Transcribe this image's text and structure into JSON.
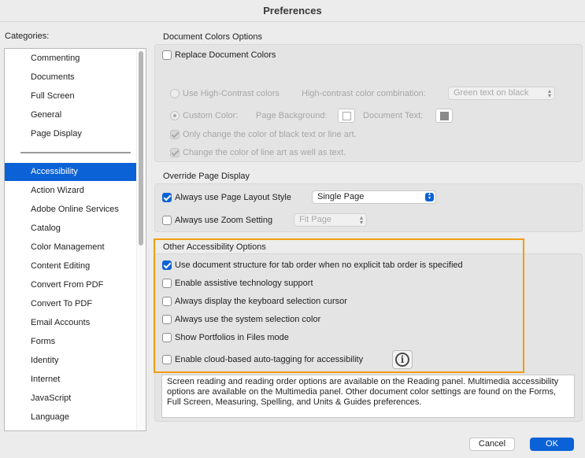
{
  "window": {
    "title": "Preferences"
  },
  "categories": {
    "label": "Categories:",
    "items_top": [
      "Commenting",
      "Documents",
      "Full Screen",
      "General",
      "Page Display"
    ],
    "items_bottom": [
      "Accessibility",
      "Action Wizard",
      "Adobe Online Services",
      "Catalog",
      "Color Management",
      "Content Editing",
      "Convert From PDF",
      "Convert To PDF",
      "Email Accounts",
      "Forms",
      "Identity",
      "Internet",
      "JavaScript",
      "Language"
    ],
    "selected": "Accessibility"
  },
  "document_colors": {
    "title": "Document Colors Options",
    "replace_label": "Replace Document Colors",
    "replace_checked": false,
    "high_contrast_label": "Use High-Contrast colors",
    "high_contrast_combo_label": "High-contrast color combination:",
    "high_contrast_combo_value": "Green text on black",
    "custom_color_label": "Custom Color:",
    "page_background_label": "Page Background:",
    "document_text_label": "Document Text:",
    "only_black_label": "Only change the color of black text or line art.",
    "line_art_label": "Change the color of line art as well as text."
  },
  "override_page_display": {
    "title": "Override Page Display",
    "page_layout_label": "Always use Page Layout Style",
    "page_layout_checked": true,
    "page_layout_value": "Single Page",
    "zoom_label": "Always use Zoom Setting",
    "zoom_checked": false,
    "zoom_value": "Fit Page"
  },
  "other_accessibility": {
    "title": "Other Accessibility Options",
    "options": [
      {
        "label": "Use document structure for tab order when no explicit tab order is specified",
        "checked": true
      },
      {
        "label": "Enable assistive technology support",
        "checked": false
      },
      {
        "label": "Always display the keyboard selection cursor",
        "checked": false
      },
      {
        "label": "Always use the system selection color",
        "checked": false
      },
      {
        "label": "Show Portfolios in Files mode",
        "checked": false
      },
      {
        "label": "Enable cloud-based auto-tagging for accessibility",
        "checked": false
      }
    ],
    "info_icon": "info-icon"
  },
  "description": "Screen reading and reading order options are available on the Reading panel. Multimedia accessibility options are available on the Multimedia panel. Other document color settings are found on the Forms, Full Screen, Measuring, Spelling, and Units & Guides preferences.",
  "buttons": {
    "cancel": "Cancel",
    "ok": "OK"
  },
  "colors": {
    "accent": "#0b62d6",
    "highlight_border": "#f39c12"
  }
}
